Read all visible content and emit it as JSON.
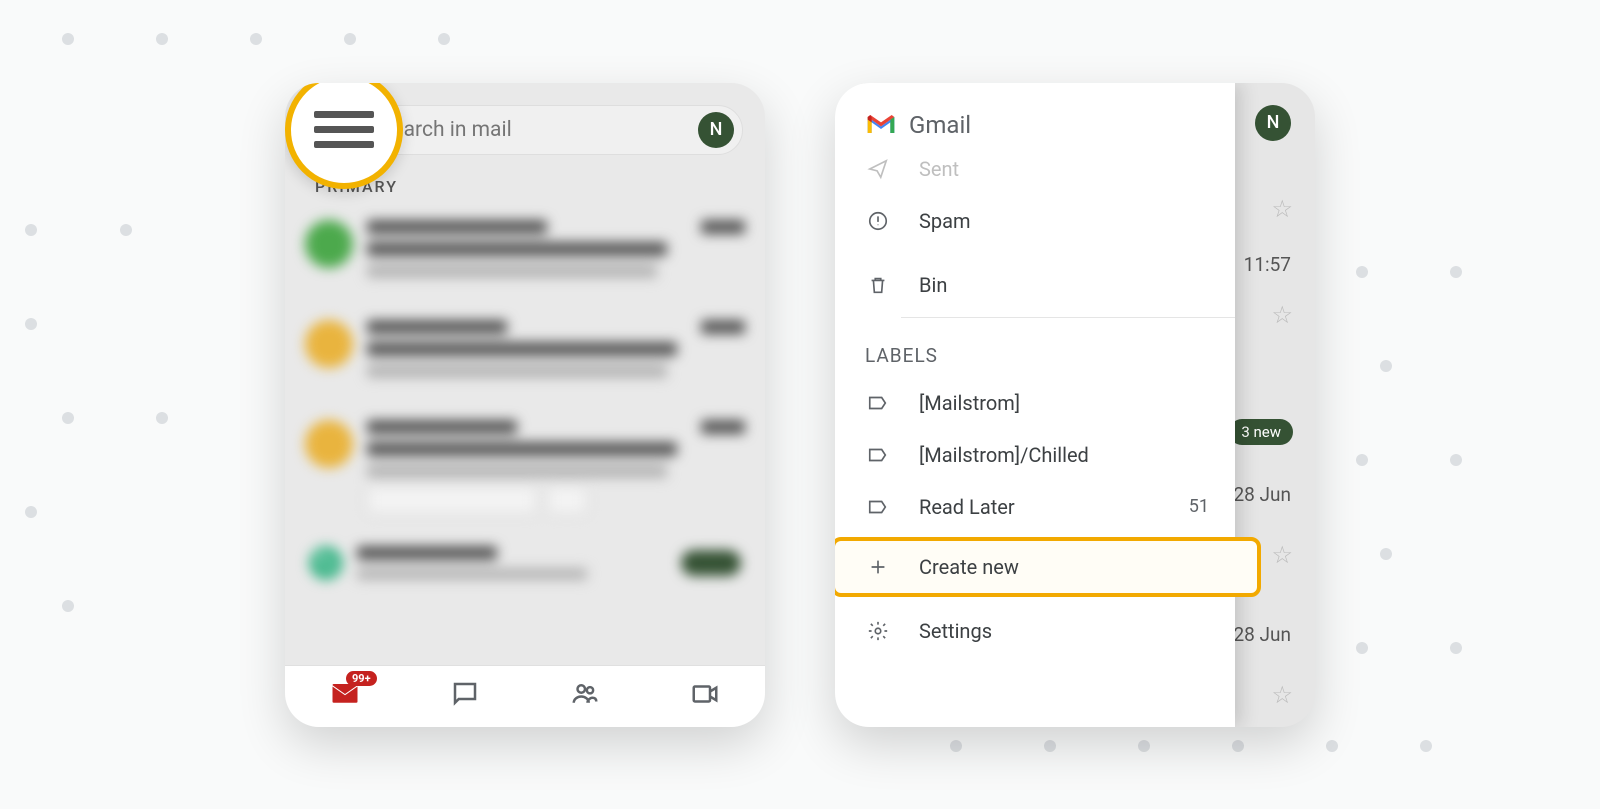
{
  "left": {
    "search_placeholder": "Search in mail",
    "avatar_initial": "N",
    "tab": "PRIMARY",
    "nav_badge": "99+"
  },
  "right": {
    "avatar_initial": "N",
    "behind_time": "11:57",
    "behind_badge": "3 new",
    "behind_date1": "28 Jun",
    "behind_date2": "28 Jun",
    "drawer": {
      "brand": "Gmail",
      "sent": "Sent",
      "spam": "Spam",
      "bin": "Bin",
      "labels_header": "LABELS",
      "label1": "[Mailstrom]",
      "label2": "[Mailstrom]/Chilled",
      "label3": "Read Later",
      "label3_count": "51",
      "create": "Create new",
      "settings": "Settings"
    }
  }
}
